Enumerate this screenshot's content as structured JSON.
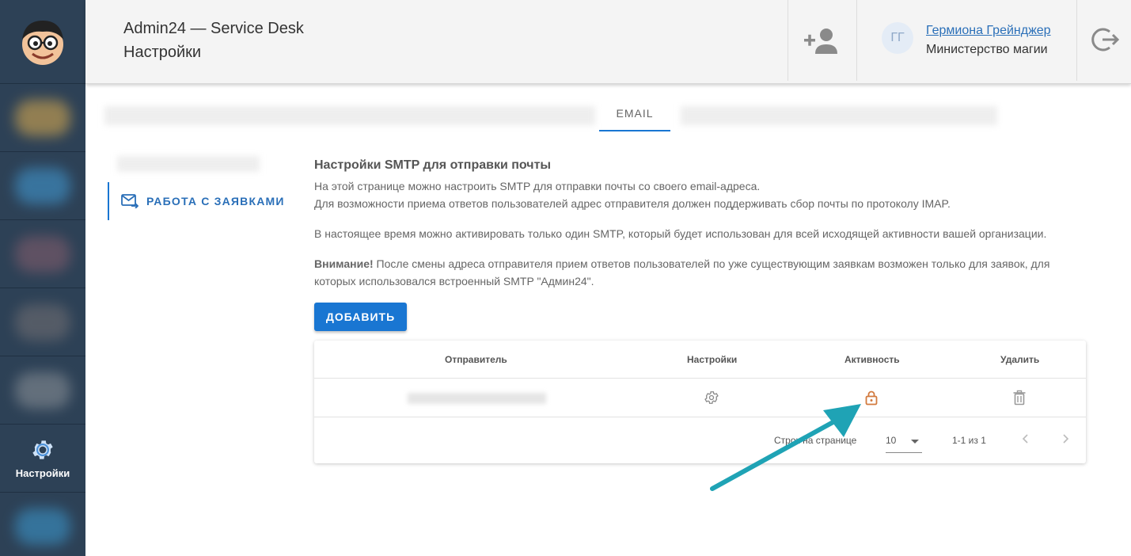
{
  "header": {
    "title": "Admin24 — Service Desk",
    "subtitle": "Настройки",
    "user_initials": "ГГ",
    "user_name": "Гермиона Грейнджер",
    "user_org": "Министерство магии"
  },
  "sidebar": {
    "active_label": "Настройки"
  },
  "tabs": {
    "active": "EMAIL"
  },
  "side_menu": {
    "item_label": "РАБОТА С ЗАЯВКАМИ"
  },
  "content": {
    "title": "Настройки SMTP для отправки почты",
    "line1": "На этой странице можно настроить SMTP для отправки почты со своего email-адреса.",
    "line2": "Для возможности приема ответов пользователей адрес отправителя должен поддерживать сбор почты по протоколу IMAP.",
    "line3": "В настоящее время можно активировать только один SMTP, который будет использован для всей исходящей активности вашей организации.",
    "warning_bold": "Внимание!",
    "warning_text": " После смены адреса отправителя прием ответов пользователей по уже существующим заявкам возможен только для заявок, для которых использовался встроенный SMTP \"Админ24\".",
    "add_button": "ДОБАВИТЬ"
  },
  "table": {
    "columns": [
      "Отправитель",
      "Настройки",
      "Активность",
      "Удалить"
    ],
    "rows_per_page_label": "Строк на странице",
    "rows_per_page_value": "10",
    "range": "1-1 из 1"
  },
  "colors": {
    "primary": "#1976d2",
    "sidebar": "#2d4156",
    "lock": "#d27a3e",
    "arrow": "#1fa3b5"
  }
}
